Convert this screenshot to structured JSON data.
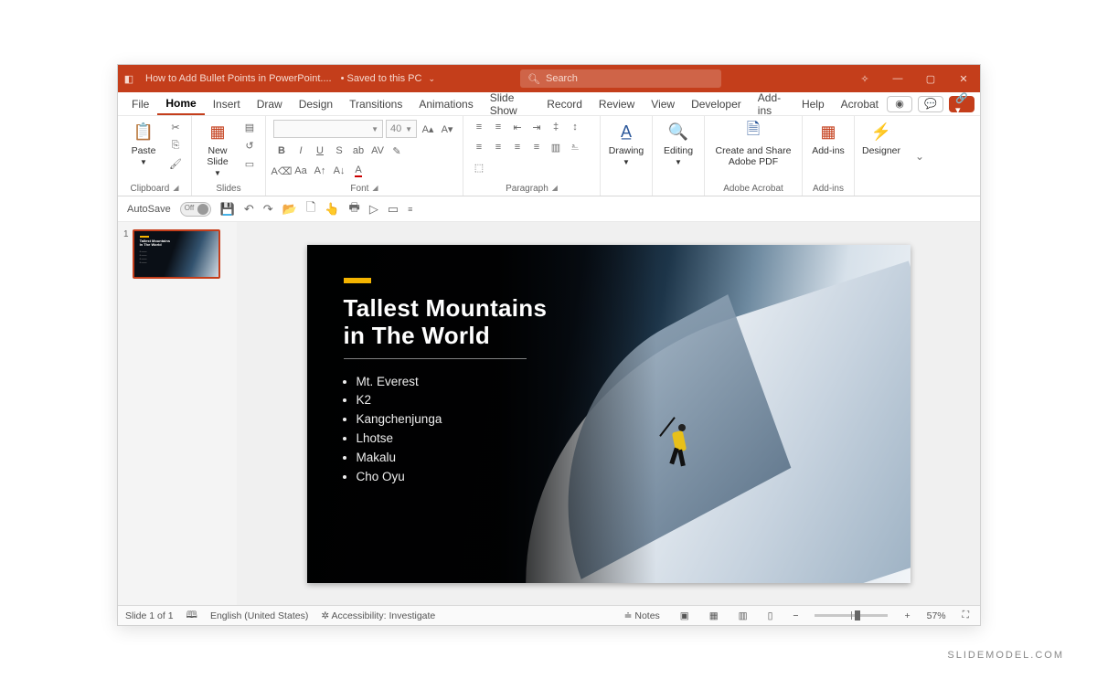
{
  "titlebar": {
    "document_name": "How to Add Bullet Points in PowerPoint....",
    "save_status": "Saved to this PC",
    "search_placeholder": "Search"
  },
  "tabs": [
    "File",
    "Home",
    "Insert",
    "Draw",
    "Design",
    "Transitions",
    "Animations",
    "Slide Show",
    "Record",
    "Review",
    "View",
    "Developer",
    "Add-ins",
    "Help",
    "Acrobat"
  ],
  "active_tab": "Home",
  "ribbon": {
    "clipboard": {
      "paste": "Paste",
      "label": "Clipboard"
    },
    "slides": {
      "new_slide": "New\nSlide",
      "label": "Slides"
    },
    "font": {
      "placeholder_font": "",
      "size": "40",
      "label": "Font"
    },
    "paragraph": {
      "label": "Paragraph"
    },
    "drawing": {
      "label": "Drawing"
    },
    "editing": {
      "label": "Editing"
    },
    "adobe": {
      "btn": "Create and Share\nAdobe PDF",
      "label": "Adobe Acrobat"
    },
    "addins": {
      "btn": "Add-ins",
      "label": "Add-ins"
    },
    "designer": {
      "btn": "Designer"
    }
  },
  "qat": {
    "autosave": "AutoSave",
    "autosave_state": "Off"
  },
  "thumbnails": [
    {
      "number": "1"
    }
  ],
  "slide": {
    "title_line1": "Tallest Mountains",
    "title_line2": "in The World",
    "bullets": [
      "Mt. Everest",
      "K2",
      "Kangchenjunga",
      "Lhotse",
      "Makalu",
      "Cho Oyu"
    ]
  },
  "status": {
    "slide_counter": "Slide 1 of 1",
    "language": "English (United States)",
    "accessibility": "Accessibility: Investigate",
    "notes": "Notes",
    "zoom": "57%"
  },
  "watermark": "SLIDEMODEL.COM"
}
